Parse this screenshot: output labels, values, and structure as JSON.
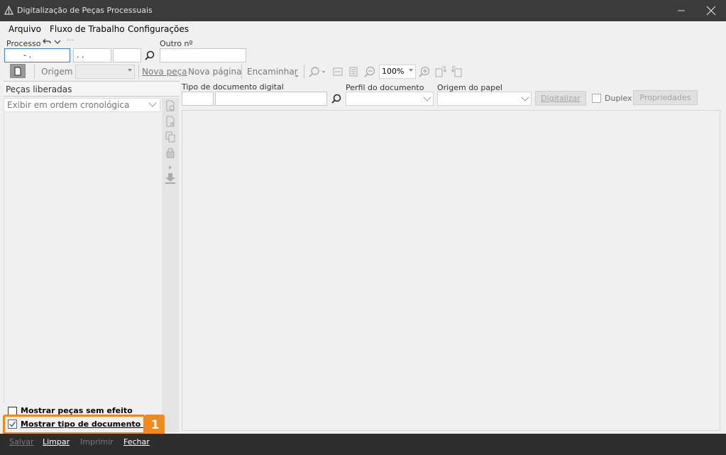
{
  "window": {
    "title": "Digitalização de Peças Processuais"
  },
  "menu": {
    "file": "Arquivo",
    "workflow": "Fluxo de Trabalho",
    "settings": "Configurações"
  },
  "process": {
    "label": "Processo",
    "field1_value": "-  .",
    "field2_value": ". .",
    "other_label": "Outro nº"
  },
  "toolbar": {
    "origin_label": "Origem",
    "new_piece": "Nova peça",
    "new_page": "Nova página",
    "forward": "Encaminhar",
    "zoom_value": "100%"
  },
  "left_panel": {
    "header": "Peças liberadas",
    "order_select": "Exibir em ordem cronológica",
    "show_without_effect": "Mostrar peças sem efeito",
    "show_doc_type": "Mostrar tipo de documento SAJ",
    "show_without_effect_checked": false,
    "show_doc_type_checked": true
  },
  "highlight_badge": "1",
  "scan": {
    "doc_type_label": "Tipo de documento digital",
    "profile_label": "Perfil do documento",
    "paper_origin_label": "Origem do papel",
    "scan_button": "Digitalizar",
    "duplex_label": "Duplex",
    "properties_button": "Propriedades"
  },
  "bottom": {
    "save": "Salvar",
    "clear": "Limpar",
    "print": "Imprimir",
    "close": "Fechar"
  },
  "colors": {
    "accent": "#f08a1e",
    "titlebar": "#3b3b3b",
    "bottombar": "#2d2d2d",
    "focus": "#3c7fd1"
  }
}
